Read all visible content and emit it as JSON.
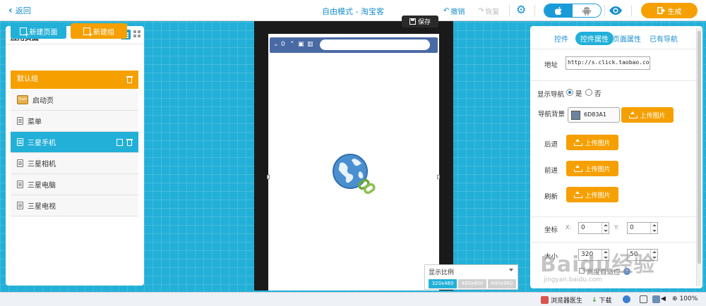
{
  "topbar": {
    "back_label": "返回",
    "title": "自由模式 - 淘宝客",
    "undo_label": "撤销",
    "redo_label": "恢复",
    "generate_label": "生成"
  },
  "left_panel": {
    "title": "应用页面",
    "new_page_label": "新建页面",
    "new_group_label": "新建组",
    "group_label": "默认组",
    "start_icon_text": "Start",
    "pages": [
      {
        "label": "启动页"
      },
      {
        "label": "菜单"
      },
      {
        "label": "三星手机"
      },
      {
        "label": "三星相机"
      },
      {
        "label": "三星电脑"
      },
      {
        "label": "三星电视"
      }
    ],
    "selected_page": "三星手机"
  },
  "phone": {
    "save_label": "保存",
    "browser_count": "0",
    "url_value": ""
  },
  "scale": {
    "title": "显示比例",
    "options": [
      "320x480",
      "480x800",
      "640x960"
    ],
    "selected": "320x480"
  },
  "right_panel": {
    "tabs": [
      "控件",
      "控件属性",
      "页面属性",
      "已有导航"
    ],
    "active_tab": "控件属性",
    "address_label": "地址",
    "address_value": "http://s.click.taobao.com/",
    "show_nav_label": "显示导航",
    "yes_label": "是",
    "no_label": "否",
    "nav_bg_label": "导航背景",
    "nav_bg_color_text": "6D83A1",
    "upload_label": "上传图片",
    "back_label": "后退",
    "forward_label": "前进",
    "refresh_label": "刷新",
    "coords_label": "坐标",
    "x_label": "X:",
    "x_value": "0",
    "y_label": "Y:",
    "y_value": "0",
    "size_label": "大小",
    "width_value": "320",
    "height_value": "50",
    "adaptive_label": "高度自适应"
  },
  "colors": {
    "blue": "#23b0d8",
    "orange": "#f5a000",
    "nav_bg": "#6d83a1"
  },
  "watermark": {
    "main": "Baidu经验",
    "sub": "jingyan.baidu.com"
  },
  "statusbar": {
    "doctor_label": "浏览器医生",
    "download_label": "下载",
    "zoom_label": "100%"
  }
}
